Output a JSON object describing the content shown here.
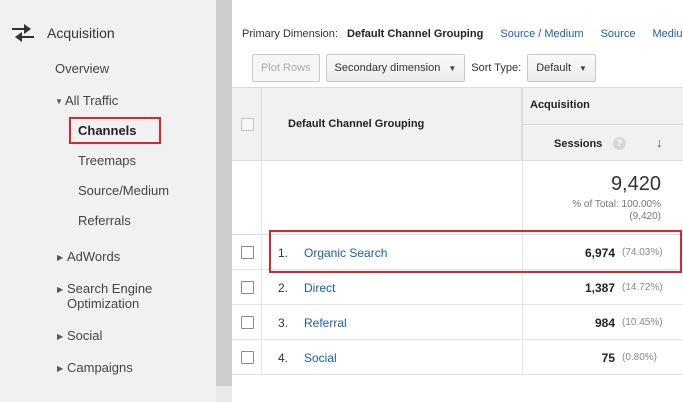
{
  "sidebar": {
    "section_label": "Acquisition",
    "section_icon": "acquisition-arrows-icon",
    "overview_label": "Overview",
    "all_traffic_label": "All Traffic",
    "sub_items": [
      {
        "label": "Channels",
        "selected": true
      },
      {
        "label": "Treemaps",
        "selected": false
      },
      {
        "label": "Source/Medium",
        "selected": false
      },
      {
        "label": "Referrals",
        "selected": false
      }
    ],
    "collapsed_items": [
      {
        "label": "AdWords"
      },
      {
        "label": "Search Engine Optimization"
      },
      {
        "label": "Social"
      },
      {
        "label": "Campaigns"
      }
    ]
  },
  "primary_dimension": {
    "label": "Primary Dimension:",
    "current": "Default Channel Grouping",
    "options": [
      "Source / Medium",
      "Source",
      "Medium"
    ]
  },
  "toolbar": {
    "plot_rows_label": "Plot Rows",
    "secondary_dimension_label": "Secondary dimension",
    "sort_type_label": "Sort Type:",
    "sort_type_value": "Default"
  },
  "table": {
    "column_dimension": "Default Channel Grouping",
    "group_header": "Acquisition",
    "metric_header": "Sessions",
    "help_glyph": "?",
    "sort_glyph": "↓",
    "total": {
      "value": "9,420",
      "pct_line": "% of Total: 100.00%",
      "abs_line": "(9,420)"
    },
    "rows": [
      {
        "index": "1.",
        "name": "Organic Search",
        "sessions": "6,974",
        "pct": "(74.03%)"
      },
      {
        "index": "2.",
        "name": "Direct",
        "sessions": "1,387",
        "pct": "(14.72%)"
      },
      {
        "index": "3.",
        "name": "Referral",
        "sessions": "984",
        "pct": "(10.45%)"
      },
      {
        "index": "4.",
        "name": "Social",
        "sessions": "75",
        "pct": "(0.80%)"
      }
    ]
  },
  "colors": {
    "highlight": "#d9262f",
    "link": "#1a5ea8"
  }
}
